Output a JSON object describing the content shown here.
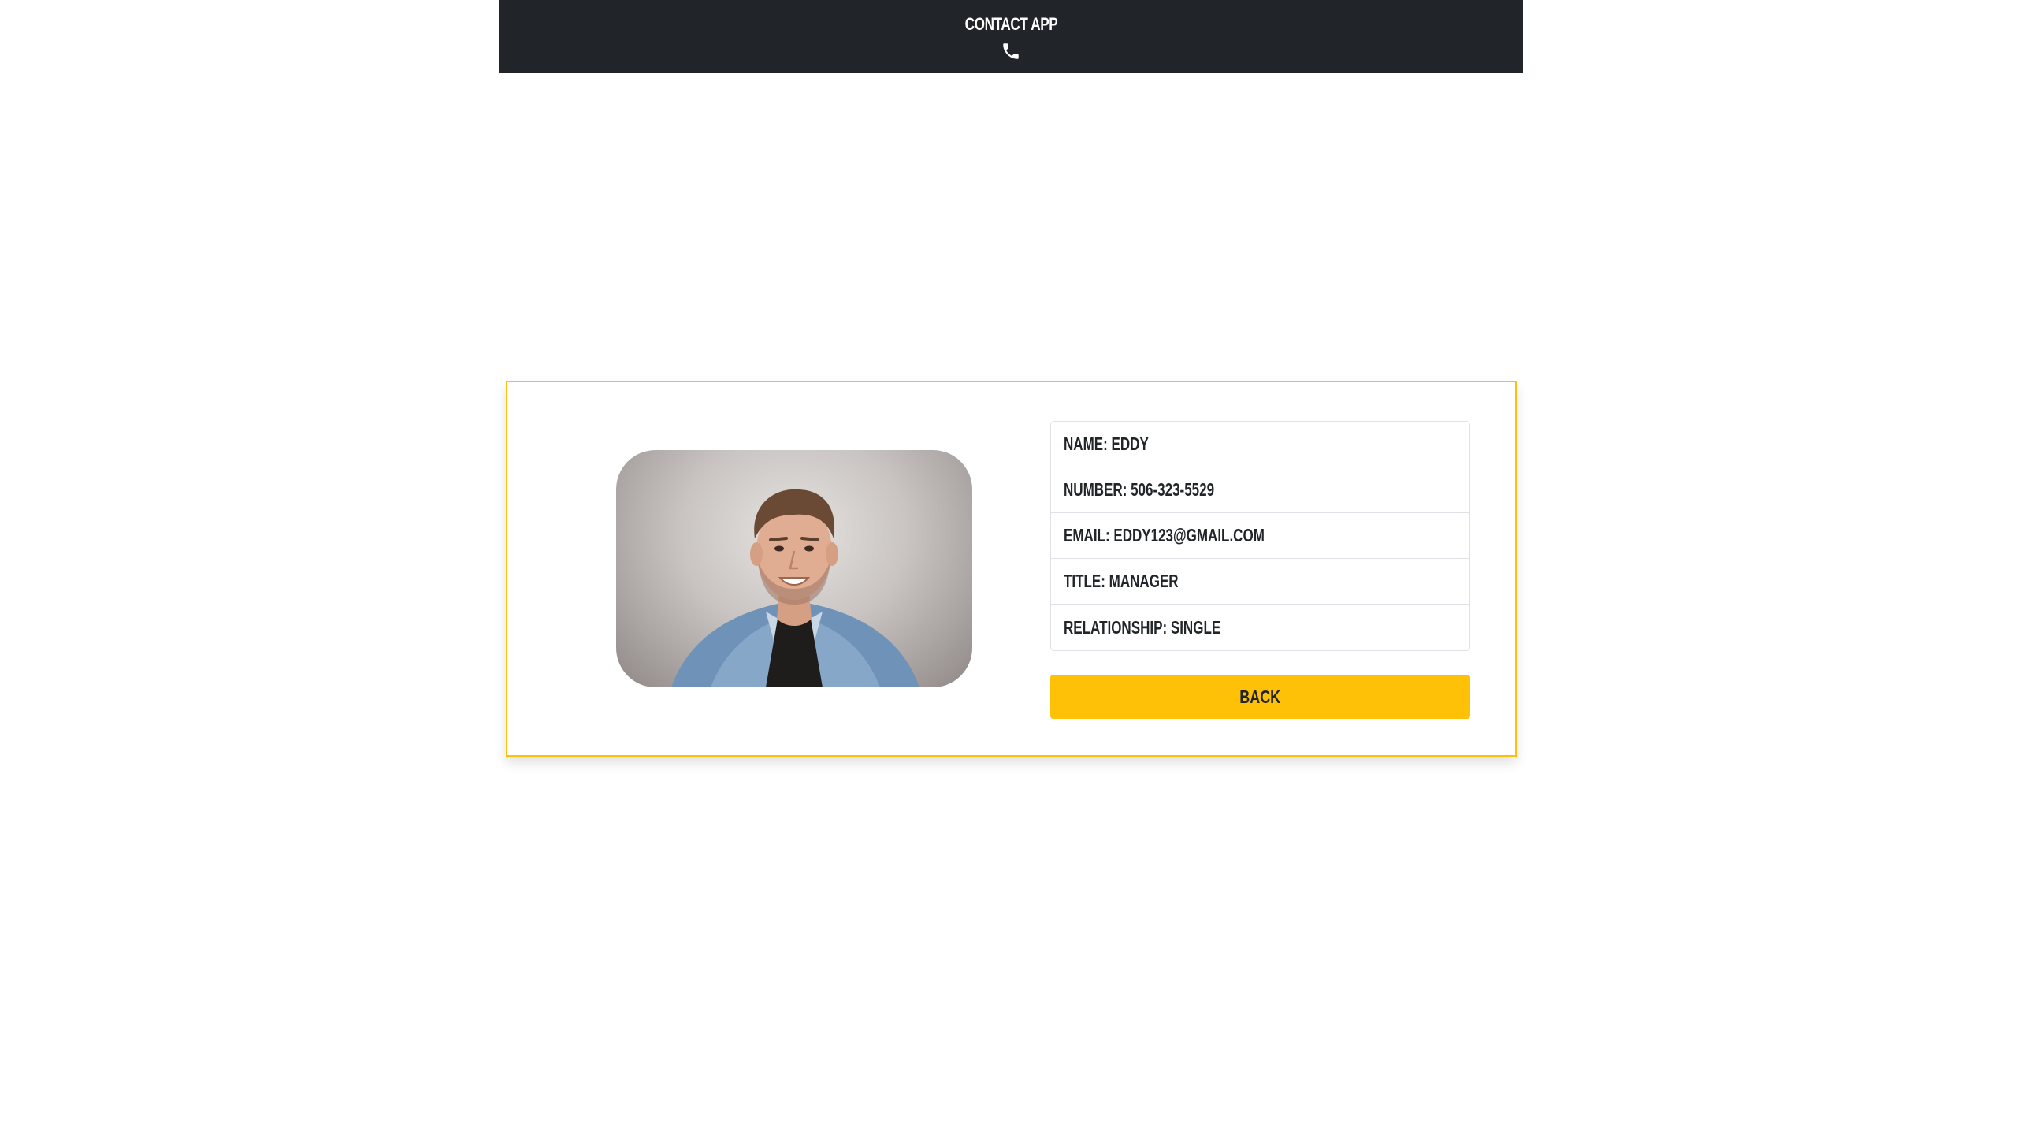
{
  "header": {
    "app_title": "CONTACT APP",
    "icon": "phone-icon"
  },
  "contact": {
    "photo_icon": "contact-photo",
    "fields": [
      {
        "text": "NAME: EDDY"
      },
      {
        "text": "NUMBER: 506-323-5529"
      },
      {
        "text": "EMAIL: EDDY123@GMAIL.COM"
      },
      {
        "text": "TITLE: MANAGER"
      },
      {
        "text": "RELATIONSHIP: SINGLE"
      }
    ],
    "back_label": "BACK"
  },
  "colors": {
    "navbar": "#212529",
    "accent": "#ffc107",
    "text": "#212529",
    "border": "#dee2e6"
  }
}
